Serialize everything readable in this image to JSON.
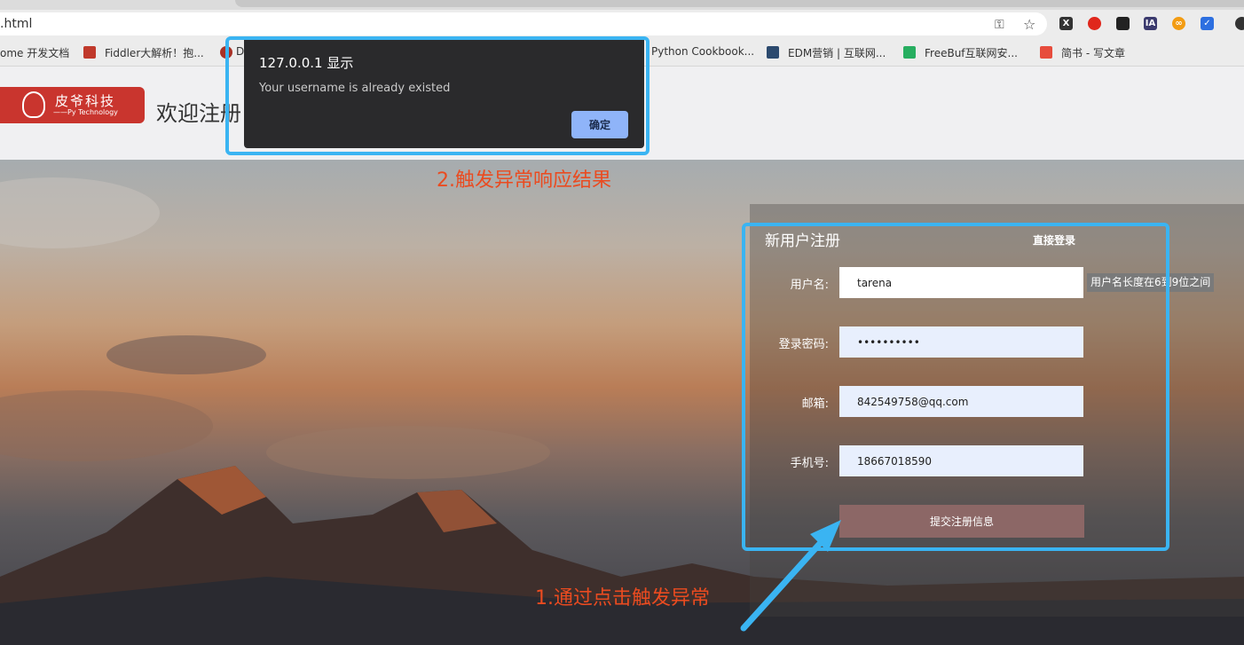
{
  "browser": {
    "url_text": ".html",
    "bookmarks": [
      {
        "label": "ome 开发文档"
      },
      {
        "label": "Fiddler大解析！抱..."
      },
      {
        "label": "D"
      },
      {
        "label": "Python Cookbook..."
      },
      {
        "label": "EDM营销 | 互联网..."
      },
      {
        "label": "FreeBuf互联网安..."
      },
      {
        "label": "简书 - 写文章"
      }
    ],
    "extensions": [
      "X",
      "",
      ",",
      "IA",
      "∞",
      "✓"
    ]
  },
  "header": {
    "logo_brand": "皮爷科技",
    "logo_sub": "——Py Technology",
    "welcome_text": "欢迎注册"
  },
  "form": {
    "title": "新用户注册",
    "login_link": "直接登录",
    "username_label": "用户名:",
    "username_value": "tarena",
    "username_hint": "用户名长度在6到9位之间",
    "password_label": "登录密码:",
    "password_value": "••••••••••",
    "email_label": "邮箱:",
    "email_value": "842549758@qq.com",
    "phone_label": "手机号:",
    "phone_value": "18667018590",
    "submit_label": "提交注册信息"
  },
  "dialog": {
    "title": "127.0.0.1 显示",
    "message": "Your username is already existed",
    "ok_label": "确定"
  },
  "annotations": {
    "step1": "1.通过点击触发异常",
    "step2": "2.触发异常响应结果"
  },
  "colors": {
    "annotation_box": "#3ab4f2",
    "annotation_text": "#ea4b20",
    "submit_button": "#8c6766",
    "logo_bg": "#c9352e",
    "dialog_button": "#8fb4f9"
  }
}
